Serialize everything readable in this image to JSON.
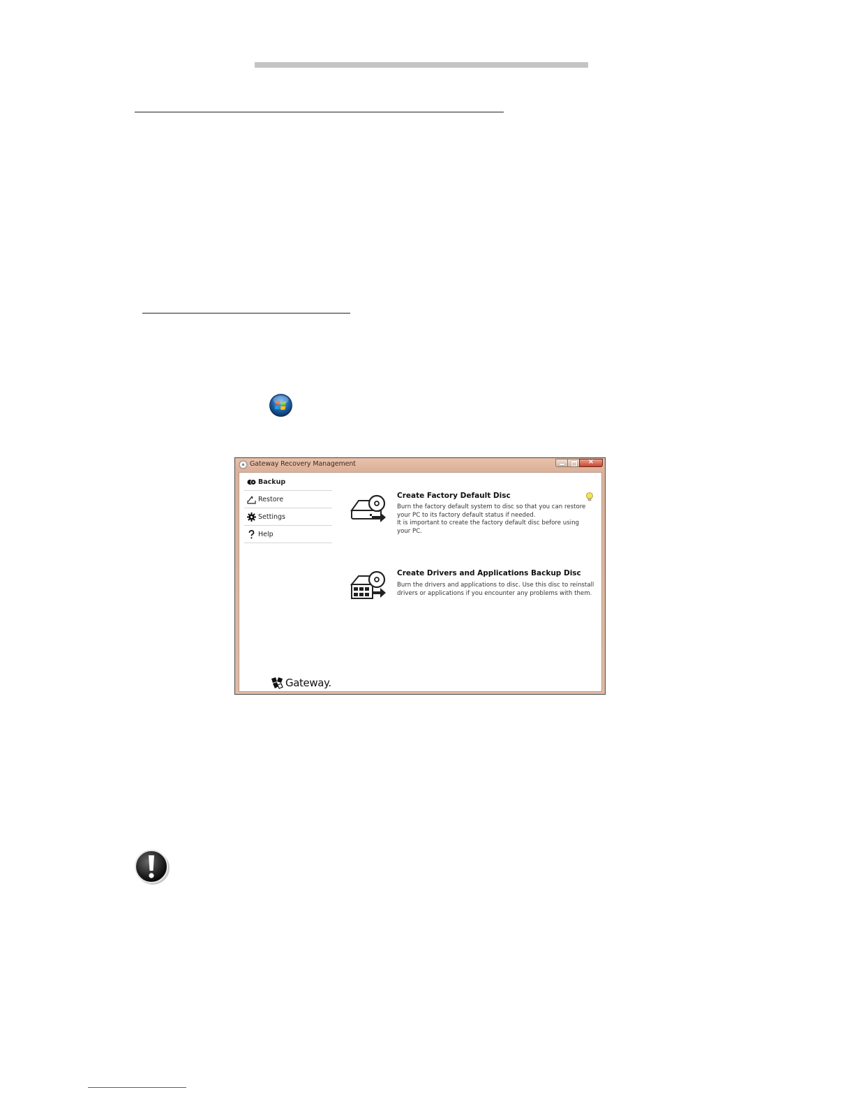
{
  "window": {
    "title": "Gateway Recovery Management",
    "close_glyph": "×",
    "sidebar": {
      "items": [
        {
          "label": "Backup",
          "icon": "backup-disc-icon",
          "active": true
        },
        {
          "label": "Restore",
          "icon": "restore-icon",
          "active": false
        },
        {
          "label": "Settings",
          "icon": "gear-icon",
          "active": false
        },
        {
          "label": "Help",
          "icon": "question-icon",
          "active": false
        }
      ]
    },
    "tasks": [
      {
        "title": "Create Factory Default Disc",
        "description": [
          "Burn the factory default system to disc so that you can restore",
          "your PC to its factory default status if needed.",
          "It is important to create the factory default disc before using",
          "your PC."
        ],
        "icon": "factory-disc-icon"
      },
      {
        "title": "Create Drivers and Applications Backup Disc",
        "description": [
          "Burn the drivers and applications to disc. Use this disc to reinstall",
          "drivers or applications if you encounter any problems with them."
        ],
        "icon": "drivers-disc-icon"
      }
    ],
    "tip_icon": "lightbulb-icon",
    "brand": "Gateway."
  },
  "page_icons": {
    "start": "windows-start-orb-icon",
    "warning": "exclamation-warning-icon"
  },
  "colors": {
    "header_bar": "#c4c4c4",
    "window_frame": "#deb39b",
    "close_button": "#c9452e",
    "footer_rule": "#4a55c8"
  }
}
